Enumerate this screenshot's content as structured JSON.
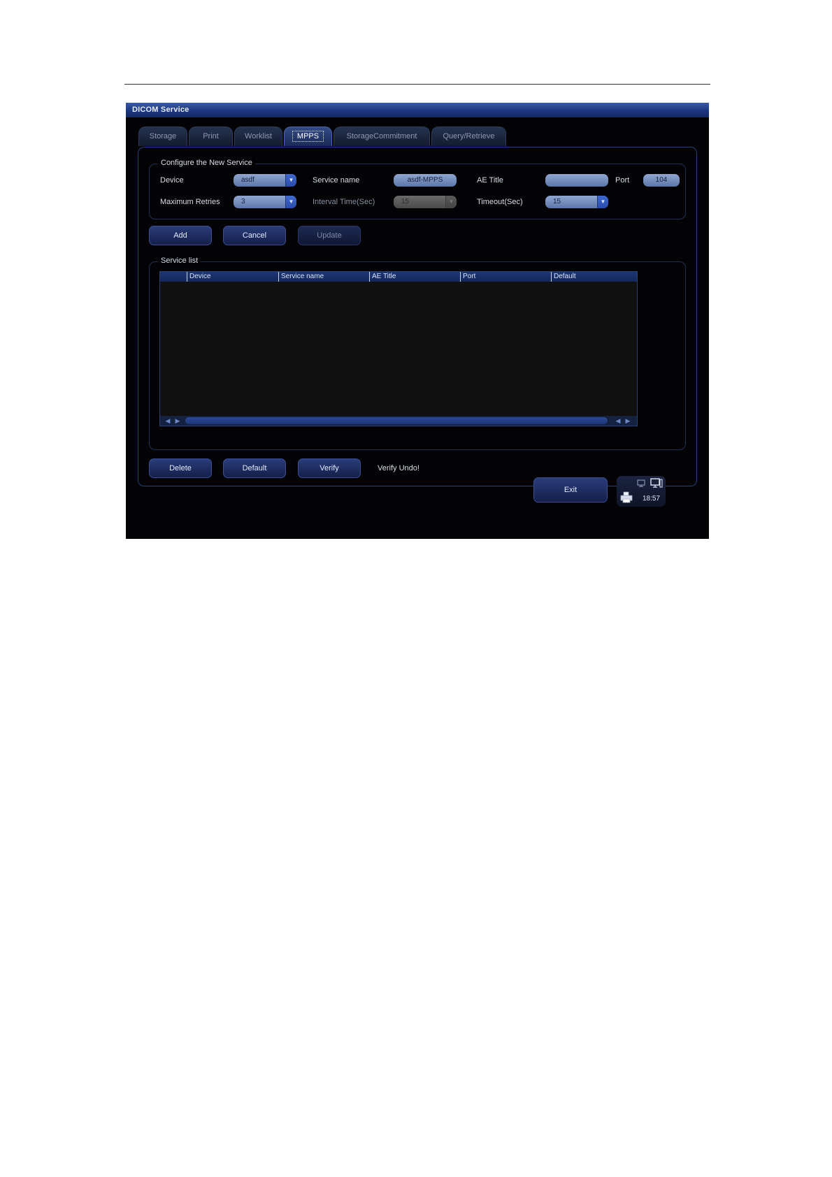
{
  "window": {
    "title": "DICOM Service",
    "tabs": [
      "Storage",
      "Print",
      "Worklist",
      "MPPS",
      "StorageCommitment",
      "Query/Retrieve"
    ],
    "active_tab": "MPPS"
  },
  "configure": {
    "title": "Configure the New Service",
    "device_label": "Device",
    "device_value": "asdf",
    "service_name_label": "Service name",
    "service_name_value": "asdf-MPPS",
    "ae_title_label": "AE Title",
    "ae_title_value": "",
    "port_label": "Port",
    "port_value": "104",
    "max_retries_label": "Maximum Retries",
    "max_retries_value": "3",
    "interval_label": "Interval Time(Sec)",
    "interval_value": "15",
    "timeout_label": "Timeout(Sec)",
    "timeout_value": "15"
  },
  "actions": {
    "add": "Add",
    "cancel": "Cancel",
    "update": "Update"
  },
  "service_list": {
    "title": "Service list",
    "columns": [
      "Device",
      "Service name",
      "AE Title",
      "Port",
      "Default"
    ],
    "rows": []
  },
  "bottom_actions": {
    "delete": "Delete",
    "default": "Default",
    "verify": "Verify",
    "verify_status": "Verify Undo!"
  },
  "exit": "Exit",
  "status": {
    "time": "18:57"
  },
  "icons": {
    "dropdown": "chevron-down-icon",
    "scroll_left": "arrow-left-icon",
    "scroll_right": "arrow-right-icon",
    "printer": "printer-icon",
    "network": "network-icon",
    "monitor": "monitor-icon"
  },
  "colors": {
    "accent": "#1c3680",
    "background": "#030305",
    "field": "#7790c0"
  }
}
